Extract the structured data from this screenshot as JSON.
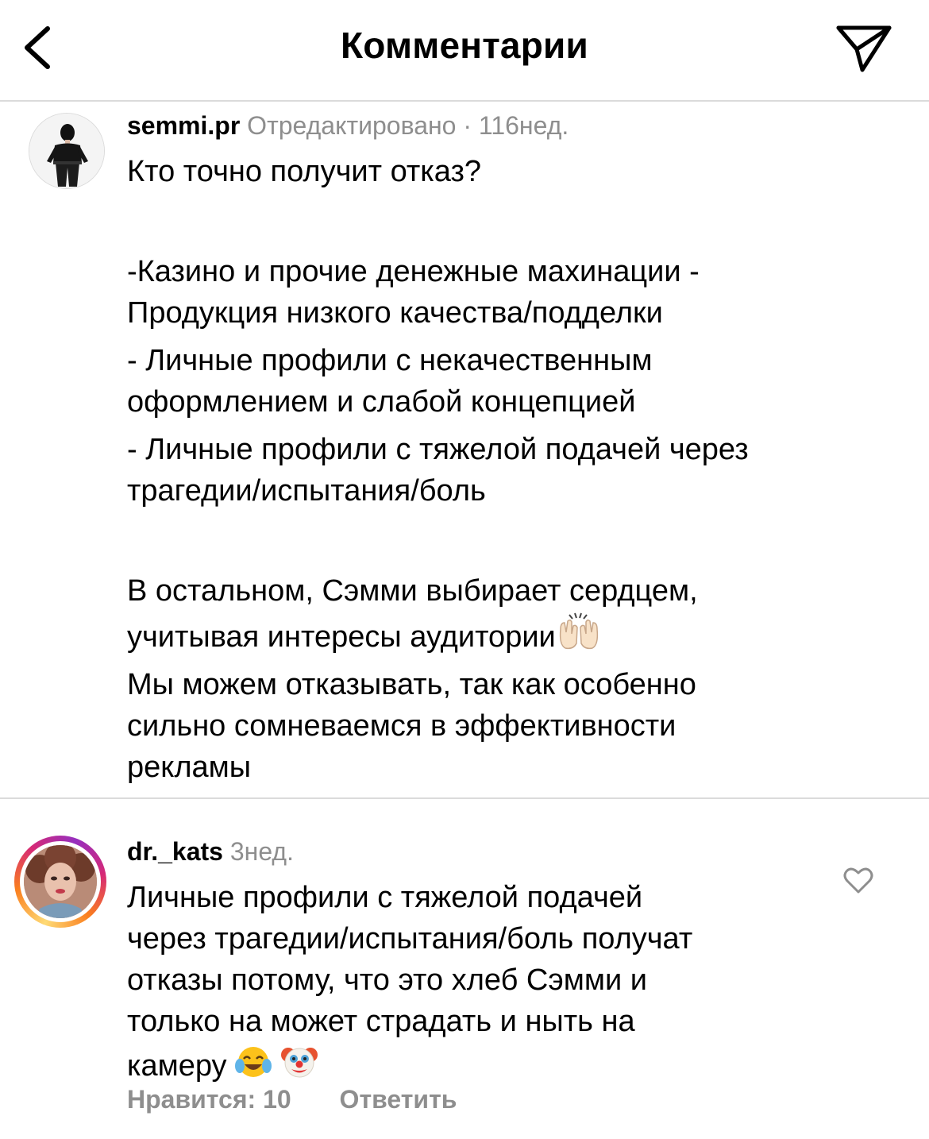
{
  "header": {
    "title": "Комментарии",
    "back_icon": "chevron-left-icon",
    "send_icon": "paper-plane-icon"
  },
  "caption": {
    "username": "semmi.pr",
    "edited": "Отредактировано",
    "separator": "·",
    "time": "116нед.",
    "lines": {
      "l1": "Кто точно получит отказ?",
      "l2": "-Казино и прочие денежные махинации -",
      "l3": "Продукция низкого качества/подделки",
      "l4": "- Личные профили с некачественным",
      "l5": "оформлением и слабой концепцией",
      "l6": "- Личные профили с тяжелой подачей через",
      "l7": "трагедии/испытания/боль",
      "l8": "В остальном, Сэмми выбирает сердцем,",
      "l9": "учитывая интересы аудитории",
      "l10": "Мы можем отказывать, так как особенно",
      "l11": "сильно сомневаемся в эффективности",
      "l12": "рекламы"
    },
    "emoji_icon": "raising-hands-emoji"
  },
  "reply": {
    "username": "dr._kats",
    "time": "3нед.",
    "lines": {
      "l1": "Личные профили с тяжелой подачей",
      "l2": "через трагедии/испытания/боль получат",
      "l3": "отказы потому, что это хлеб Сэмми и",
      "l4": "только на может страдать и ныть на",
      "l5": "камеру"
    },
    "emoji_icons": [
      "tears-of-joy-emoji",
      "clown-face-emoji"
    ],
    "likes": "Нравится: 10",
    "reply_label": "Ответить",
    "like_icon": "heart-outline-icon"
  },
  "colors": {
    "text": "#000000",
    "muted": "#8e8e8e",
    "divider": "#dbdbdb",
    "story_ring": [
      "#feda75",
      "#fa7e1e",
      "#d62976",
      "#962fbf"
    ]
  }
}
